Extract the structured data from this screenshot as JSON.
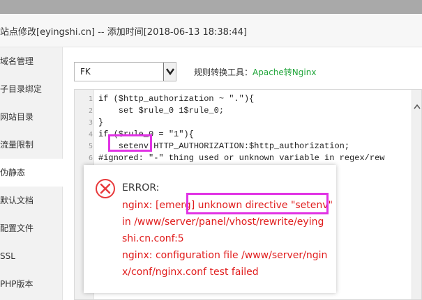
{
  "window": {
    "title": "站点修改[eyingshi.cn] -- 添加时间[2018-06-13 18:38:44]"
  },
  "sidebar": {
    "items": [
      {
        "label": "域名管理"
      },
      {
        "label": "子目录绑定"
      },
      {
        "label": "网站目录"
      },
      {
        "label": "流量限制"
      },
      {
        "label": "伪静态",
        "active": true
      },
      {
        "label": "默认文档"
      },
      {
        "label": "配置文件"
      },
      {
        "label": "SSL"
      },
      {
        "label": "PHP版本"
      }
    ]
  },
  "rewrite": {
    "select_value": "FK",
    "tool_label": "规则转换工具：",
    "tool_link": "Apache转Nginx"
  },
  "editor": {
    "lines": [
      {
        "num": "1",
        "text": "if ($http_authorization ~ \".\"){"
      },
      {
        "num": "2",
        "text": "    set $rule_0 1$rule_0;"
      },
      {
        "num": "3",
        "text": "}"
      },
      {
        "num": "4",
        "text": "if ($rule_0 = \"1\"){"
      },
      {
        "num": "5",
        "text": "    setenv HTTP_AUTHORIZATION:$http_authorization;"
      },
      {
        "num": "6",
        "text": "#ignored: \"-\" thing used or unknown variable in regex/rew"
      }
    ]
  },
  "dialog": {
    "title": "ERROR:",
    "lines": [
      "nginx: [emerg] unknown directive \"setenv\"",
      "in /www/server/panel/vhost/rewrite/eying",
      "shi.cn.conf:5",
      "nginx: configuration file /www/server/ngin",
      "x/conf/nginx.conf test failed"
    ]
  },
  "colors": {
    "accent_green": "#20a53a",
    "error_red": "#e01c1c",
    "highlight_magenta": "#e133e5"
  }
}
